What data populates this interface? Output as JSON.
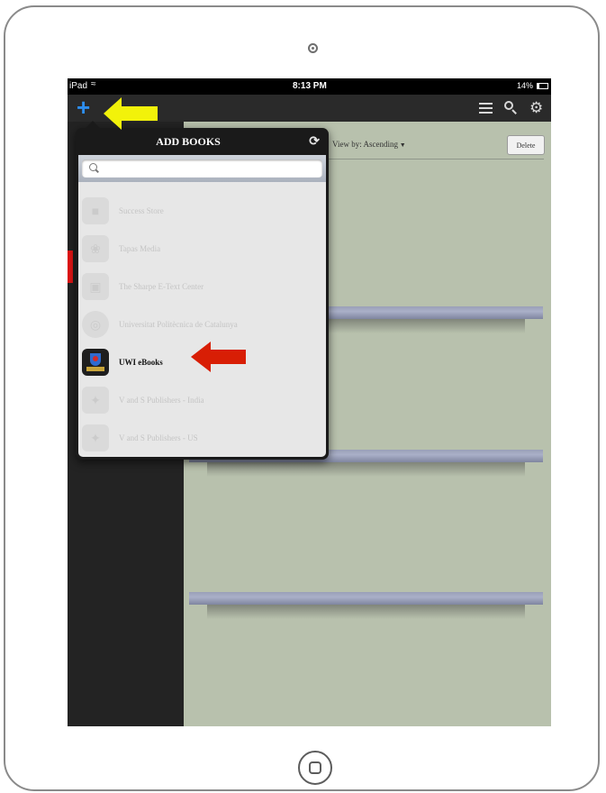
{
  "device": {
    "name": "iPad"
  },
  "statusbar": {
    "device_label": "iPad",
    "time": "8:13 PM",
    "battery": "14%"
  },
  "toolbar": {
    "add_glyph": "+",
    "icons": [
      "list-icon",
      "search-icon",
      "gear-icon"
    ]
  },
  "shelf": {
    "view_by": "View by: Ascending",
    "delete_label": "Delete"
  },
  "popover": {
    "title": "ADD BOOKS",
    "search_placeholder": "",
    "publishers": [
      {
        "name": "Success Store",
        "active": false
      },
      {
        "name": "Tapas Media",
        "active": false
      },
      {
        "name": "The Sharpe E-Text Center",
        "active": false
      },
      {
        "name": "Universitat Politècnica de Catalunya",
        "active": false
      },
      {
        "name": "UWI eBooks",
        "active": true
      },
      {
        "name": "V and S Publishers - India",
        "active": false
      },
      {
        "name": "V and S Publishers - US",
        "active": false
      }
    ]
  },
  "colors": {
    "shelf_background": "#b8c1ad",
    "add_button": "#2d8ef0",
    "highlight_yellow_arrow": "#f2f20a",
    "highlight_red_arrow": "#d81e05"
  }
}
